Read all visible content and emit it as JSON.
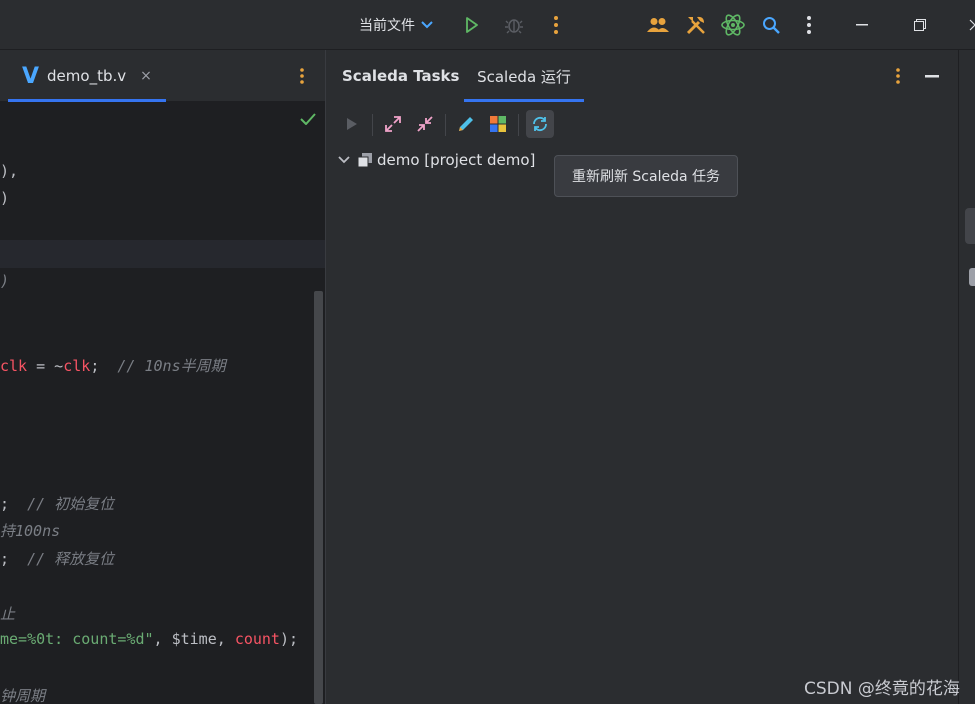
{
  "toolbar": {
    "run_config": "当前文件",
    "icons": [
      "chevron-down-icon",
      "run-icon",
      "debug-icon",
      "more-vertical-icon",
      "users-icon",
      "build-tools-icon",
      "atom-icon",
      "search-icon",
      "more-vertical-icon",
      "minimize-icon",
      "restore-icon",
      "close-icon"
    ]
  },
  "editor": {
    "tab_icon_letter": "V",
    "tab_label": "demo_tb.v",
    "tab_close": "×",
    "code": {
      "l1": "),",
      "l2": ")",
      "l4": ")",
      "l5_var": "clk",
      "l5_eq": " = ~",
      "l5_var2": "clk",
      "l5_semi": ";  ",
      "l5_cmt": "// 10ns半周期",
      "l6_semi": ";  ",
      "l6_cmt": "// 初始复位",
      "l7": "持100ns",
      "l8_semi": ";  ",
      "l8_cmt": "// 释放复位",
      "l9": "止",
      "l10_str": "me=%0t: count=%d\"",
      "l10_mid": ", $time, ",
      "l10_var": "count",
      "l10_end": ");",
      "l11": "钟周期"
    }
  },
  "tool_window": {
    "tabs": [
      "Scaleda Tasks",
      "Scaleda 运行"
    ],
    "active_tab": 1,
    "tree": {
      "label": "demo [project demo]"
    },
    "tooltip": "重新刷新 Scaleda 任务"
  },
  "watermark": "CSDN @终竟的花海",
  "colors": {
    "accent": "#3574f0",
    "run_green": "#5fb865",
    "orange": "#e8a33d",
    "keyword_red": "#f75464",
    "comment": "#7a7e85",
    "string_green": "#6aab73"
  }
}
